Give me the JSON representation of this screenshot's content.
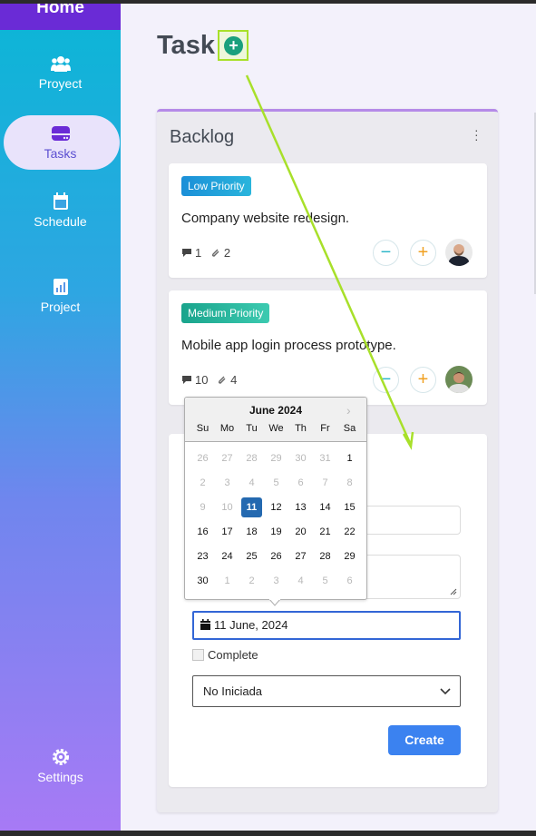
{
  "sidebar": {
    "home_label": "Home",
    "items": [
      {
        "label": "Proyect",
        "icon": "users-icon"
      },
      {
        "label": "Tasks",
        "icon": "drive-icon"
      },
      {
        "label": "Schedule",
        "icon": "calendar-icon"
      },
      {
        "label": "Project",
        "icon": "chart-icon"
      }
    ],
    "settings_label": "Settings",
    "active_item": "Tasks"
  },
  "header": {
    "title": "Task"
  },
  "column": {
    "title": "Backlog",
    "cards": [
      {
        "priority": "Low Priority",
        "title": "Company website redesign.",
        "comments": "1",
        "attachments": "2"
      },
      {
        "priority": "Medium Priority",
        "title": "Mobile app login process prototype.",
        "comments": "10",
        "attachments": "4"
      }
    ]
  },
  "form": {
    "date_value": "11 June, 2024",
    "complete_label": "Complete",
    "status_value": "No Iniciada",
    "create_label": "Create"
  },
  "datepicker": {
    "month": "June 2024",
    "weekdays": [
      "Su",
      "Mo",
      "Tu",
      "We",
      "Th",
      "Fr",
      "Sa"
    ],
    "weeks": [
      [
        "26",
        "27",
        "28",
        "29",
        "30",
        "31",
        "1"
      ],
      [
        "2",
        "3",
        "4",
        "5",
        "6",
        "7",
        "8"
      ],
      [
        "9",
        "10",
        "11",
        "12",
        "13",
        "14",
        "15"
      ],
      [
        "16",
        "17",
        "18",
        "19",
        "20",
        "21",
        "22"
      ],
      [
        "23",
        "24",
        "25",
        "26",
        "27",
        "28",
        "29"
      ],
      [
        "30",
        "1",
        "2",
        "3",
        "4",
        "5",
        "6"
      ]
    ],
    "selected": "11"
  },
  "colors": {
    "accent": "#3b82f0",
    "add_button": "#1aa07d",
    "highlight": "#a8e02a",
    "selected_day": "#2469b0"
  }
}
